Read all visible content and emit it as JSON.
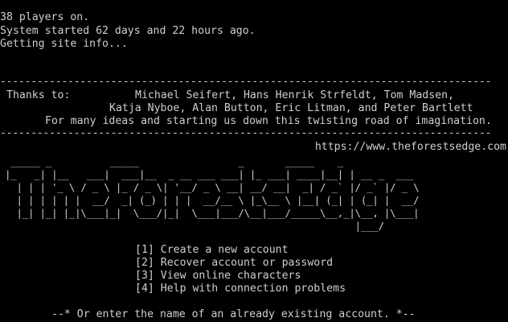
{
  "status": {
    "players": "38 players on.",
    "uptime": "System started 62 days and 22 hours ago.",
    "loading": "Getting site info..."
  },
  "credits": {
    "rule": "--------------------------------------------------------------------------------",
    "label": "Thanks to:",
    "line1": "Michael Seifert, Hans Henrik Strfeldt, Tom Madsen,",
    "line2": "Katja Nyboe, Alan Button, Eric Litman, and Peter Bartlett",
    "line3": "For many ideas and starting us down this twisting road of imagination."
  },
  "site": {
    "url": "https://www.theforestsedge.com"
  },
  "banner": {
    "ascii": " _____ _          _____                 _       _____    _            \n|_   _| |__   ___|  ___|__  _ __ ___ ___| |_ ___| ____|__| | __ _  ___ \n  | | | '_ \\ / _ \\ |_ / _ \\| '__/ _ \\ __| __/ __|  _| / _` |/ _` |/ _ \\\n  | | | | | |  __/  _| (_) | | |  __/__ \\ |_\\__ \\ |__| (_| | (_| |  __/\n  |_| |_| |_|\\___|_|  \\___/|_|  \\___|___/\\__|___/_____\\__,_|\\__, |\\___|\n                                                            |___/      "
  },
  "menu": {
    "items": [
      "[1] Create a new account",
      "[2] Recover account or password",
      "[3] View online characters",
      "[4] Help with connection problems"
    ]
  },
  "prompt": {
    "text": "--* Or enter the name of an already existing account. *--"
  },
  "colors": {
    "background": "#000000",
    "text": "#cfcfcf"
  }
}
